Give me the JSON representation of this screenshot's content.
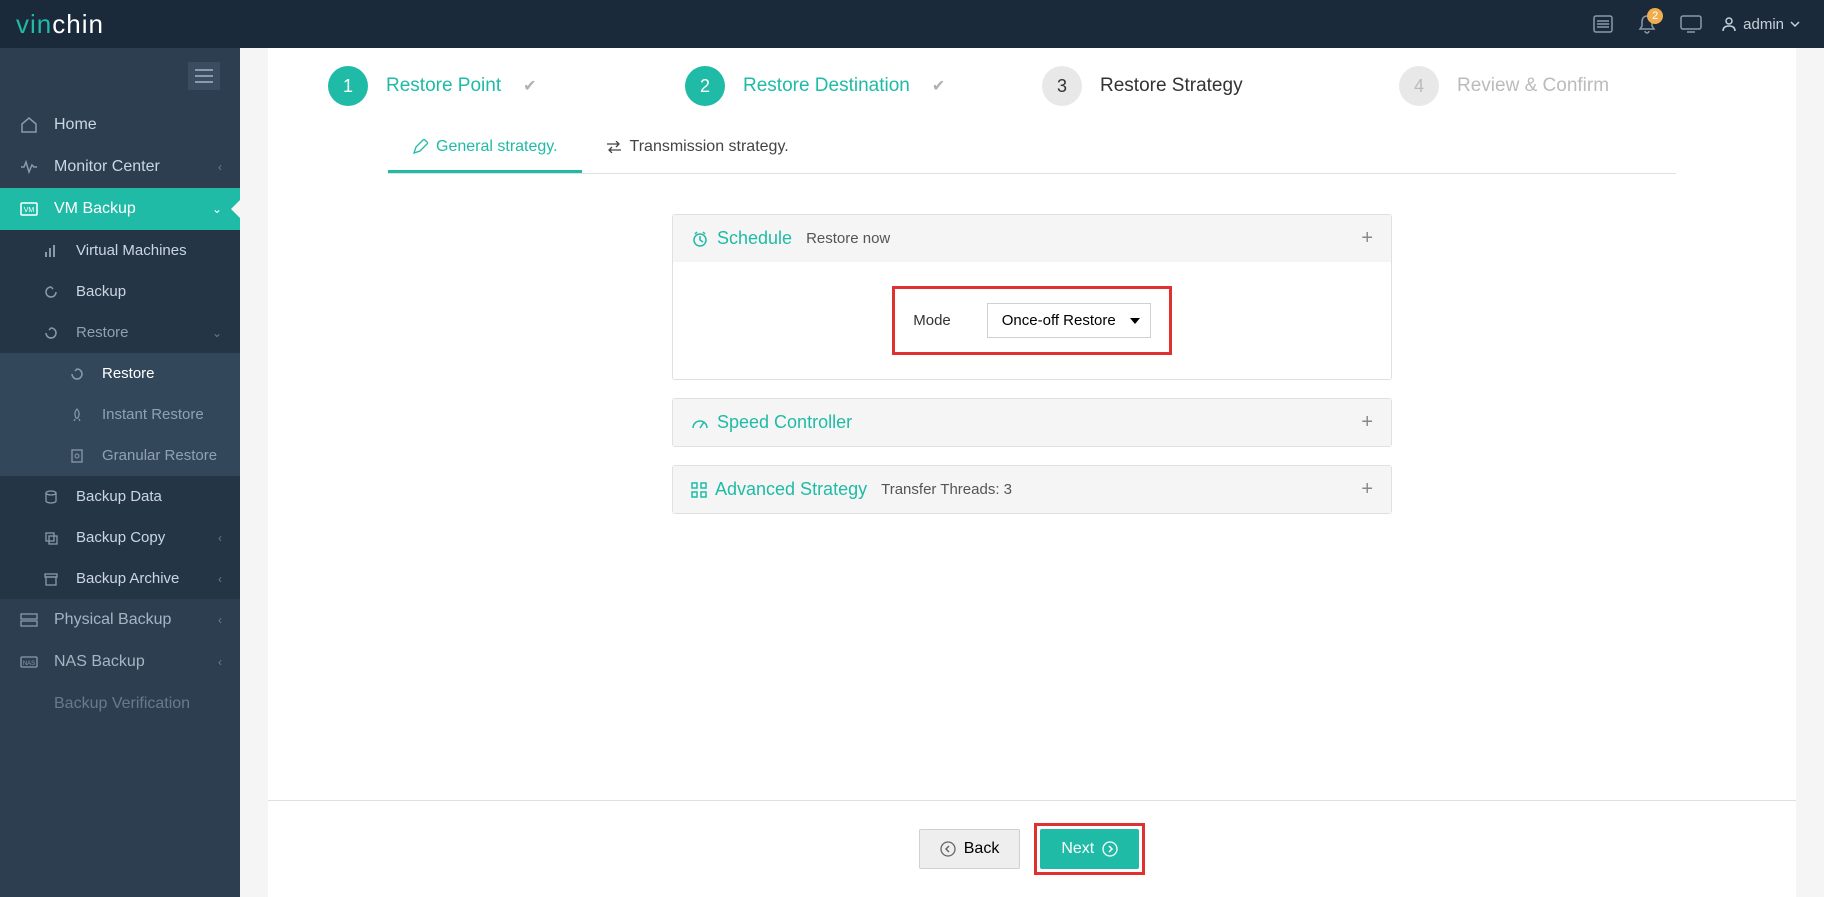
{
  "brand": {
    "part1": "vin",
    "part2": "chin"
  },
  "topbar": {
    "notif_count": "2",
    "user": "admin"
  },
  "sidebar": {
    "home": "Home",
    "monitor": "Monitor Center",
    "vm_backup": "VM Backup",
    "virtual_machines": "Virtual Machines",
    "backup": "Backup",
    "restore": "Restore",
    "restore_sub": "Restore",
    "instant_restore": "Instant Restore",
    "granular_restore": "Granular Restore",
    "backup_data": "Backup Data",
    "backup_copy": "Backup Copy",
    "backup_archive": "Backup Archive",
    "physical_backup": "Physical Backup",
    "nas_backup": "NAS Backup",
    "backup_verification": "Backup Verification"
  },
  "steps": {
    "s1": {
      "num": "1",
      "label": "Restore Point"
    },
    "s2": {
      "num": "2",
      "label": "Restore Destination"
    },
    "s3": {
      "num": "3",
      "label": "Restore Strategy"
    },
    "s4": {
      "num": "4",
      "label": "Review & Confirm"
    }
  },
  "tabs": {
    "general": "General strategy.",
    "transmission": "Transmission strategy."
  },
  "schedule": {
    "title": "Schedule",
    "subtitle": "Restore now",
    "mode_label": "Mode",
    "mode_value": "Once-off Restore"
  },
  "speed": {
    "title": "Speed Controller"
  },
  "advanced": {
    "title": "Advanced Strategy",
    "subtitle": "Transfer Threads: 3"
  },
  "footer": {
    "back": "Back",
    "next": "Next"
  }
}
